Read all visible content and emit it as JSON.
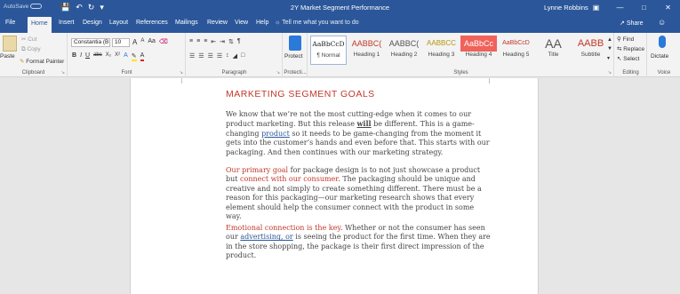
{
  "titlebar": {
    "autosave": "AutoSave",
    "autosave_state": "Off",
    "qat": [
      "save-icon",
      "undo-icon",
      "redo-icon",
      "customize-icon"
    ],
    "doc_title": "2Y Market Segment Performance",
    "user": "Lynne Robbins",
    "window_controls": [
      "ribbon-display-icon",
      "minimize-icon",
      "restore-icon",
      "close-icon"
    ]
  },
  "tabs": [
    "File",
    "Home",
    "Insert",
    "Design",
    "Layout",
    "References",
    "Mailings",
    "Review",
    "View",
    "Help"
  ],
  "active_tab": "Home",
  "tell_me": "Tell me what you want to do",
  "share": "Share",
  "ribbon": {
    "clipboard": {
      "paste": "Paste",
      "cut": "Cut",
      "copy": "Copy",
      "format_painter": "Format Painter",
      "label": "Clipboard"
    },
    "font": {
      "font_name": "Constantia (B",
      "font_size": "10",
      "grow": "A",
      "shrink": "A",
      "case": "Aa",
      "bold": "B",
      "italic": "I",
      "underline": "U",
      "strike": "abc",
      "subscript": "X₂",
      "superscript": "X²",
      "label": "Font"
    },
    "paragraph": {
      "label": "Paragraph"
    },
    "protect": {
      "button": "Protect",
      "label": "Protecti..."
    },
    "styles": {
      "label": "Styles",
      "items": [
        {
          "preview": "AaBbCcD",
          "name": "¶ Normal",
          "color": "#333333"
        },
        {
          "preview": "AABBC(",
          "name": "Heading 1",
          "color": "#c0392b"
        },
        {
          "preview": "AABBC(",
          "name": "Heading 2",
          "color": "#555555"
        },
        {
          "preview": "AABBCC",
          "name": "Heading 3",
          "color": "#b7950b"
        },
        {
          "preview": "AaBbCc",
          "name": "Heading 4",
          "color": "#ffffff"
        },
        {
          "preview": "AaBbCcD",
          "name": "Heading 5",
          "color": "#c0392b"
        },
        {
          "preview": "AA",
          "name": "Title",
          "color": "#555555"
        },
        {
          "preview": "AABB",
          "name": "Subtitle",
          "color": "#c0392b"
        }
      ]
    },
    "editing": {
      "find": "Find",
      "replace": "Replace",
      "select": "Select",
      "label": "Editing"
    },
    "voice": {
      "dictate": "Dictate",
      "label": "Voice"
    }
  },
  "document": {
    "heading": "MARKETING SEGMENT GOALS",
    "p1": {
      "a": "We know that we’re not the most cutting-edge when it comes to our product marketing. But this release ",
      "will": "will",
      "b": " be different. This is a game-changing ",
      "product": "product",
      "c": " so it needs to be game-changing from the moment it gets into the customer’s hands and even before that. This starts with our packaging. And then continues with our marketing strategy."
    },
    "p2": {
      "goal": "Our primary goal",
      "a": " for package design is to not just showcase a product but ",
      "connect": "connect with our consumer",
      "b": ". The packaging should be unique and creative and not simply to create something different. There must be a reason for this packaging—our marketing research shows that every element should help the consumer connect with the product in some way."
    },
    "p3": {
      "key": "Emotional connection is the key",
      "a": ". Whether or not the consumer has seen our ",
      "adv": "advertising, or",
      "b": " is seeing the product for the first time. When they are in the store shopping, the package is their first direct impression of the product."
    }
  },
  "colors": {
    "brand": "#2b579a",
    "heading": "#c0392b",
    "heading4_fill": "#f0625a"
  }
}
